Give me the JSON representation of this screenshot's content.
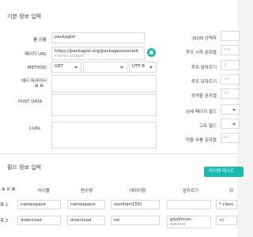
{
  "basic": {
    "title": "기본 정보 입력",
    "name_label": "룰 이름",
    "name_value": "packagist",
    "url_label": "페이지 URL",
    "url_value": "https://packagist.org/packages/socialit",
    "url_value_2": "e?action=Jinjagate",
    "method_label": "METHOD",
    "method_value": "GET",
    "param_value": "",
    "encoding_value": "UTF-8",
    "header_label_1": "헤더 파라미터",
    "header_label_2": "⊞ ⊠",
    "post_label": "POST DATA",
    "curl_label": "CURL"
  },
  "right_labels": {
    "json_selector": "JSON 선택자",
    "loop_start": "루프 시작 문자열",
    "loop_start_placeholder": "<ir",
    "loop_split": "루프 앞자르기",
    "loop_split_placeholder": "<",
    "loop_back": "루프 뒤자르기",
    "loop_back_placeholder": "</",
    "success_chars": "성격할 문자열",
    "success_placeholder": "<!",
    "detail_field": "상세 페이지 필드",
    "unique_field": "고유 필드",
    "loop_end": "약을 자를 문자열",
    "loop_end_placeholder": "<!"
  },
  "field": {
    "title": "필드 정보 입력",
    "add_button": "아이템 테스트",
    "header_icons": "⊞ ⊟ ⊠",
    "columns": [
      "타이틀",
      "변수명",
      "데이터형",
      "앞자르기",
      "뒤"
    ],
    "rows": [
      {
        "label": "목 1",
        "title": "namespace",
        "var": "namespace",
        "type": "varchar(155)",
        "front": "",
        "back": "* class"
      },
      {
        "label": "목 2",
        "title": "download",
        "var": "download",
        "type": "int",
        "front": "glyphicon-",
        "front2": "download",
        "back": "</"
      }
    ]
  }
}
